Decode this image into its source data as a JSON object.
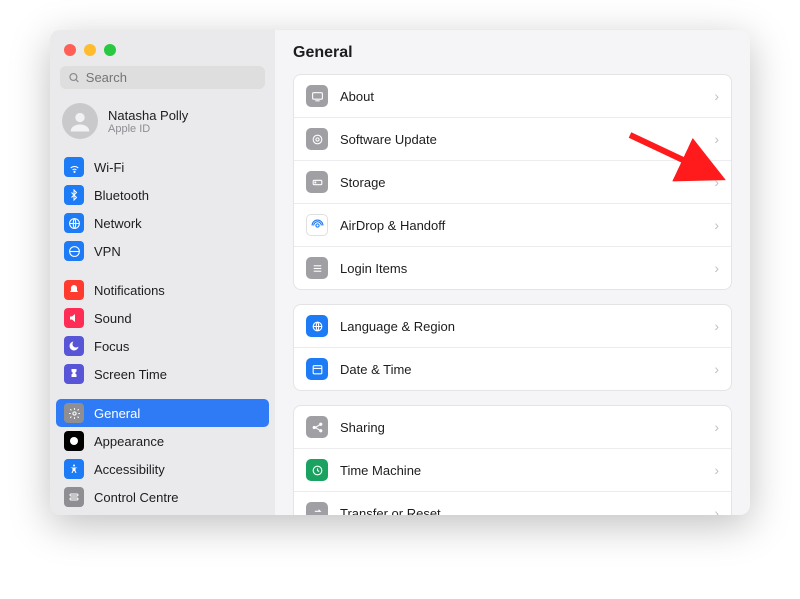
{
  "window": {
    "title": "General"
  },
  "search": {
    "placeholder": "Search"
  },
  "user": {
    "name": "Natasha Polly",
    "subtitle": "Apple ID"
  },
  "sidebar": {
    "groups": [
      {
        "items": [
          {
            "label": "Wi-Fi",
            "icon": "wifi-icon",
            "bg": "#1e7bf6"
          },
          {
            "label": "Bluetooth",
            "icon": "bluetooth-icon",
            "bg": "#1e7bf6"
          },
          {
            "label": "Network",
            "icon": "network-icon",
            "bg": "#1e7bf6"
          },
          {
            "label": "VPN",
            "icon": "vpn-icon",
            "bg": "#1e7bf6"
          }
        ]
      },
      {
        "items": [
          {
            "label": "Notifications",
            "icon": "notifications-icon",
            "bg": "#ff3b30"
          },
          {
            "label": "Sound",
            "icon": "sound-icon",
            "bg": "#ff2d55"
          },
          {
            "label": "Focus",
            "icon": "focus-icon",
            "bg": "#5856d6"
          },
          {
            "label": "Screen Time",
            "icon": "screentime-icon",
            "bg": "#5856d6"
          }
        ]
      },
      {
        "items": [
          {
            "label": "General",
            "icon": "gear-icon",
            "bg": "#8e8e93",
            "selected": true
          },
          {
            "label": "Appearance",
            "icon": "appearance-icon",
            "bg": "#000000"
          },
          {
            "label": "Accessibility",
            "icon": "accessibility-icon",
            "bg": "#1e7bf6"
          },
          {
            "label": "Control Centre",
            "icon": "control-centre-icon",
            "bg": "#8e8e93"
          }
        ]
      }
    ]
  },
  "main": {
    "groups": [
      {
        "items": [
          {
            "label": "About",
            "icon": "about-icon",
            "bg": "#9f9fa4"
          },
          {
            "label": "Software Update",
            "icon": "software-update-icon",
            "bg": "#9f9fa4"
          },
          {
            "label": "Storage",
            "icon": "storage-icon",
            "bg": "#9f9fa4"
          },
          {
            "label": "AirDrop & Handoff",
            "icon": "airdrop-icon",
            "bg": "#ffffff"
          },
          {
            "label": "Login Items",
            "icon": "login-items-icon",
            "bg": "#9f9fa4"
          }
        ]
      },
      {
        "items": [
          {
            "label": "Language & Region",
            "icon": "language-icon",
            "bg": "#1e7bf6"
          },
          {
            "label": "Date & Time",
            "icon": "date-time-icon",
            "bg": "#1e7bf6"
          }
        ]
      },
      {
        "items": [
          {
            "label": "Sharing",
            "icon": "sharing-icon",
            "bg": "#9f9fa4"
          },
          {
            "label": "Time Machine",
            "icon": "time-machine-icon",
            "bg": "#1aa260"
          },
          {
            "label": "Transfer or Reset",
            "icon": "transfer-icon",
            "bg": "#9f9fa4"
          }
        ]
      }
    ]
  },
  "annotation": {
    "arrow_points_to": "Software Update"
  }
}
